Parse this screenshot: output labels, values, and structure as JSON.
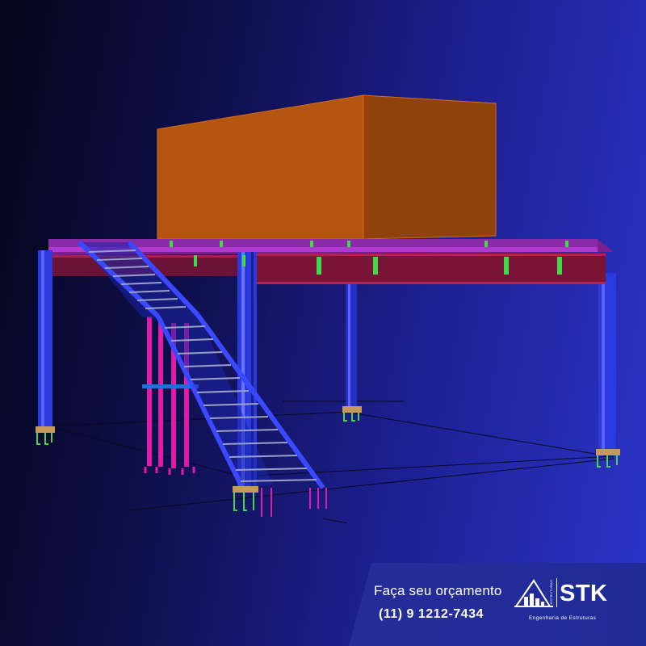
{
  "cta": {
    "title": "Faça seu orçamento",
    "phone": "(11) 9 1212-7434"
  },
  "brand": {
    "name": "STK",
    "vertical": "ESTRUTURAS",
    "tagline": "Engenharia de Estruturas"
  },
  "colors": {
    "background_dark": "#05051a",
    "background_light": "#2c34c9",
    "column_blue": "#2a3adf",
    "beam_red": "#7a1436",
    "box_orange": "#b0520e",
    "stair_magenta": "#e21aa8",
    "anchor_green": "#43d84a"
  },
  "icons": {
    "logo": "building-logo-icon"
  }
}
